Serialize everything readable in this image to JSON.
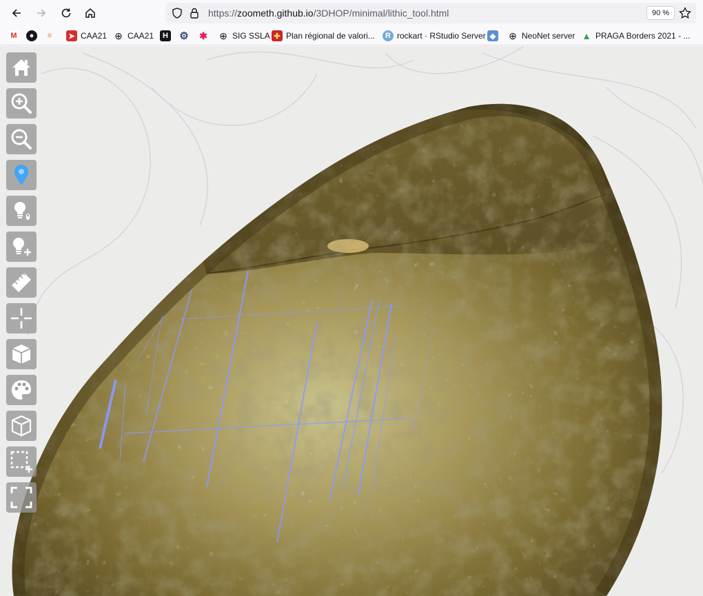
{
  "browser": {
    "url_prefix": "https://",
    "url_host": "zoometh.github.io",
    "url_path": "/3DHOP/minimal/lithic_tool.html",
    "zoom": "90 %"
  },
  "bookmarks": [
    {
      "label": "",
      "icon": "gmail-icon"
    },
    {
      "label": "",
      "icon": "github-icon"
    },
    {
      "label": "",
      "icon": "stackoverflow-icon"
    },
    {
      "label": "CAA21",
      "icon": "paper-plane-icon"
    },
    {
      "label": "CAA21",
      "icon": "globe-icon"
    },
    {
      "label": "",
      "icon": "h-icon"
    },
    {
      "label": "",
      "icon": "gear-icon"
    },
    {
      "label": "",
      "icon": "slack-icon"
    },
    {
      "label": "SIG SSLA",
      "icon": "globe-icon"
    },
    {
      "label": "Plan régional de valori...",
      "icon": "region-flag-icon"
    },
    {
      "label": "rockart · RStudio Server",
      "icon": "r-icon"
    },
    {
      "label": "",
      "icon": "shield-badge-icon"
    },
    {
      "label": "NeoNet server",
      "icon": "globe-icon"
    },
    {
      "label": "PRAGA Borders 2021 - ...",
      "icon": "drive-icon"
    }
  ],
  "toolbar": [
    {
      "name": "home",
      "icon": "home-icon"
    },
    {
      "name": "zoom-in",
      "icon": "zoom-in-icon"
    },
    {
      "name": "zoom-out",
      "icon": "zoom-out-icon"
    },
    {
      "name": "pick-point",
      "icon": "map-pin-icon"
    },
    {
      "name": "light",
      "icon": "lightbulb-icon"
    },
    {
      "name": "add-light",
      "icon": "lightbulb-plus-icon"
    },
    {
      "name": "measure",
      "icon": "ruler-icon"
    },
    {
      "name": "section",
      "icon": "crosshair-icon"
    },
    {
      "name": "solid-view",
      "icon": "cube-solid-icon"
    },
    {
      "name": "color",
      "icon": "palette-icon"
    },
    {
      "name": "wireframe",
      "icon": "cube-outline-icon"
    },
    {
      "name": "add-selection",
      "icon": "selection-plus-icon"
    },
    {
      "name": "fullscreen",
      "icon": "fullscreen-icon"
    }
  ],
  "colors": {
    "rock_dark": "#4a3f1c",
    "rock_mid": "#8e7c3e",
    "rock_light": "#c8c08a",
    "grid_line": "#7f8fff",
    "tool_bg": "#9a9a9a"
  }
}
